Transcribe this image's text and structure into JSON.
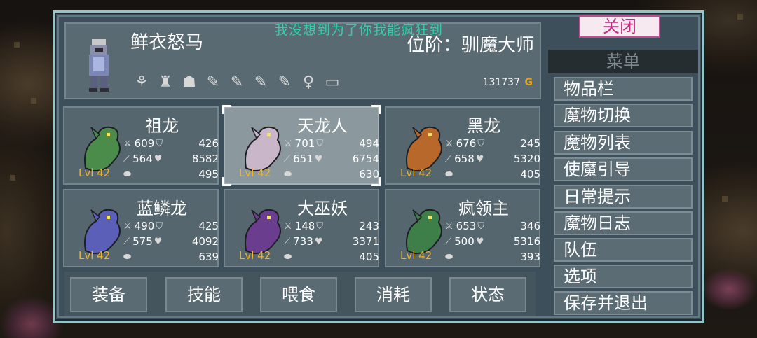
{
  "notice": "我没想到为了你我能疯狂到",
  "player": {
    "name": "鲜衣怒马",
    "rank": "位阶：驯魔大师",
    "gold": "131737",
    "gold_symbol": "G",
    "item_icons": [
      "claw-icon",
      "armor-icon",
      "mushroom-icon",
      "feather-icon",
      "feather-icon",
      "feather-icon",
      "feather-icon",
      "key-icon",
      "book-icon"
    ]
  },
  "monsters": [
    {
      "name": "祖龙",
      "level": "Lvl 42",
      "attack": "609",
      "defense": "426",
      "magic": "564",
      "health": "8582",
      "mana": "495",
      "color": "#4c8c4a"
    },
    {
      "name": "天龙人",
      "level": "Lvl 42",
      "attack": "701",
      "defense": "494",
      "magic": "651",
      "health": "6754",
      "mana": "630",
      "color": "#c9b6c8"
    },
    {
      "name": "黑龙",
      "level": "Lvl 42",
      "attack": "676",
      "defense": "245",
      "magic": "658",
      "health": "5320",
      "mana": "405",
      "color": "#b7682a"
    },
    {
      "name": "蓝鳞龙",
      "level": "Lvl 42",
      "attack": "490",
      "defense": "425",
      "magic": "575",
      "health": "4092",
      "mana": "639",
      "color": "#5c5fb8"
    },
    {
      "name": "大巫妖",
      "level": "Lvl 42",
      "attack": "148",
      "defense": "243",
      "magic": "733",
      "health": "3371",
      "mana": "405",
      "color": "#6a3d8f"
    },
    {
      "name": "疯领主",
      "level": "Lvl 42",
      "attack": "653",
      "defense": "346",
      "magic": "500",
      "health": "5316",
      "mana": "393",
      "color": "#3e7e48"
    }
  ],
  "buttons": [
    "装备",
    "技能",
    "喂食",
    "消耗",
    "状态"
  ],
  "menu": {
    "close_label": "关闭",
    "title": "菜单",
    "items": [
      "物品栏",
      "魔物切换",
      "魔物列表",
      "使魔引导",
      "日常提示",
      "魔物日志",
      "队伍",
      "选项",
      "保存并退出"
    ]
  },
  "colors": {
    "panel_border": "#93c4c8",
    "gold": "#e6a316",
    "level": "#f0b32a",
    "notice": "#2fd1a5",
    "close": "#c22a7d"
  }
}
